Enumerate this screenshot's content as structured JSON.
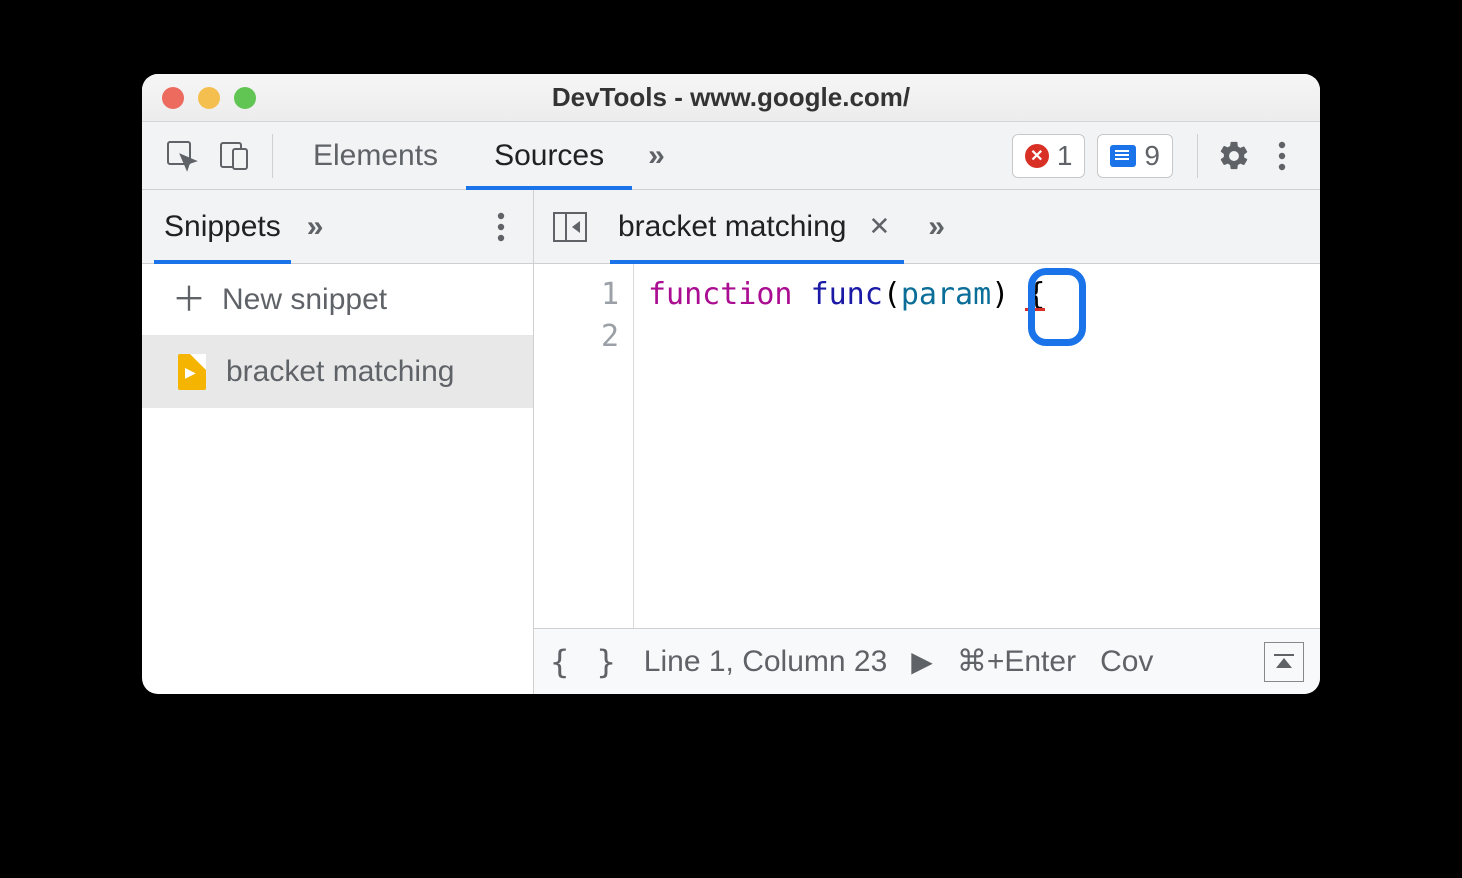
{
  "window": {
    "title": "DevTools - www.google.com/"
  },
  "toolbar": {
    "tabs": {
      "elements": "Elements",
      "sources": "Sources"
    },
    "errors_count": "1",
    "messages_count": "9"
  },
  "sidebar": {
    "tab_label": "Snippets",
    "new_snippet_label": "New snippet",
    "items": [
      {
        "name": "bracket matching"
      }
    ]
  },
  "editor": {
    "tab_label": "bracket matching",
    "gutter": [
      "1",
      "2"
    ],
    "code": {
      "kw": "function",
      "fn": "func",
      "open": "(",
      "prm": "param",
      "close": ")",
      "sp": " ",
      "brace": "{"
    }
  },
  "statusbar": {
    "position": "Line 1, Column 23",
    "run_shortcut": "⌘+Enter",
    "coverage": "Cov"
  }
}
